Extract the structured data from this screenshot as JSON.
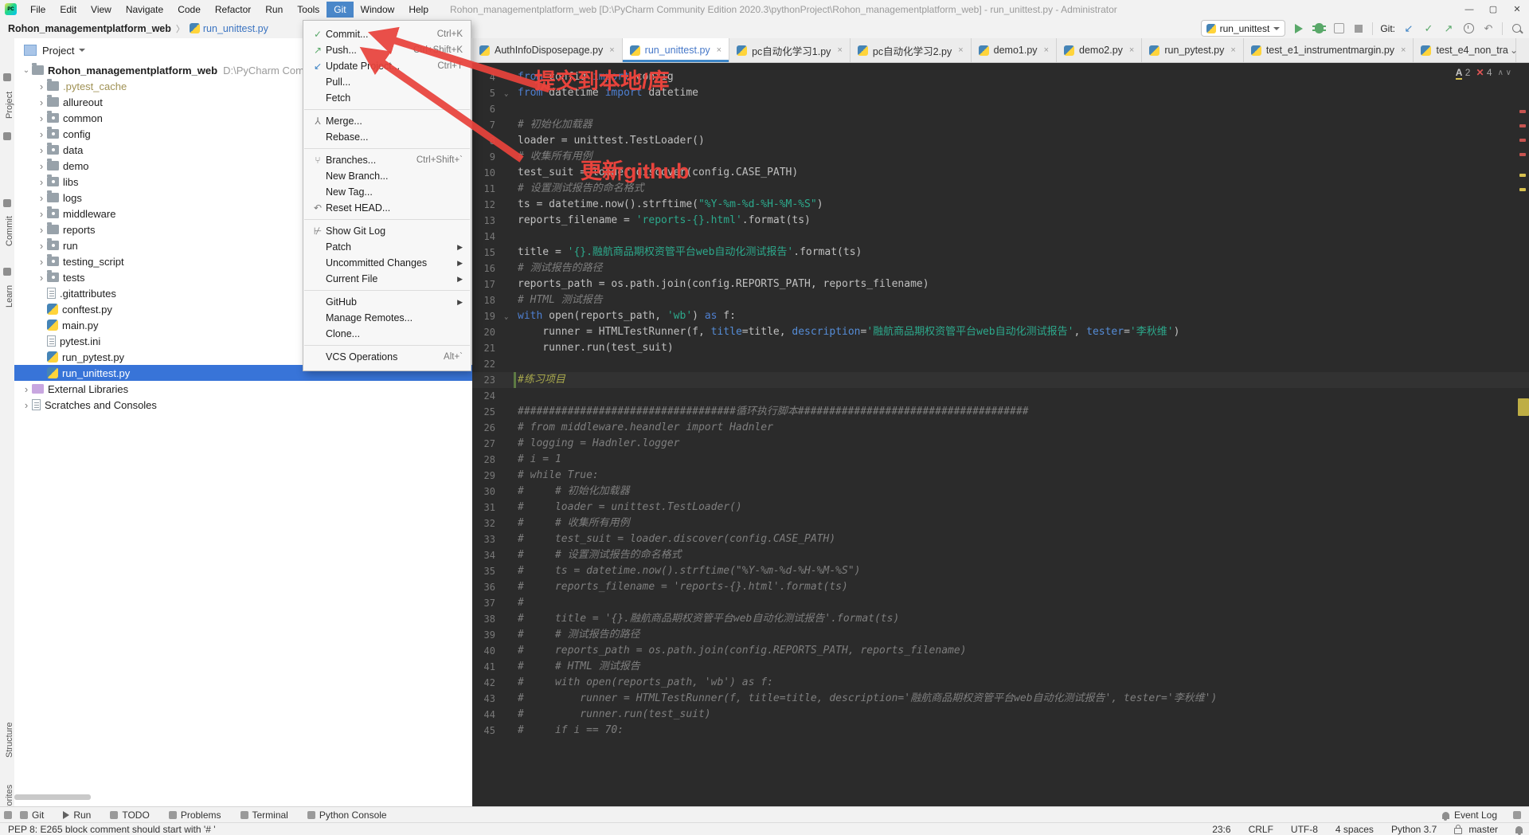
{
  "colors": {
    "accent_red": "#e8433c",
    "selection_blue": "#3874d8",
    "menu_highlight": "#4a87c9",
    "keyword": "#4e7fd0",
    "string": "#2ca98c",
    "comment": "#7e7e7e",
    "editor_bg": "#2b2b2b"
  },
  "title_bar": {
    "logo": "PC",
    "menus": [
      "File",
      "Edit",
      "View",
      "Navigate",
      "Code",
      "Refactor",
      "Run",
      "Tools",
      "Git",
      "Window",
      "Help"
    ],
    "active_menu": "Git",
    "title": "Rohon_managementplatform_web [D:\\PyCharm Community Edition 2020.3\\pythonProject\\Rohon_managementplatform_web] - run_unittest.py - Administrator",
    "window_buttons": {
      "minimize": "—",
      "maximize": "▢",
      "close": "✕"
    }
  },
  "breadcrumb": {
    "project": "Rohon_managementplatform_web",
    "separator": "〉",
    "file": "run_unittest.py"
  },
  "toolbar": {
    "run_config": "run_unittest",
    "git_label": "Git:"
  },
  "git_menu": {
    "items": [
      {
        "label": "Commit...",
        "shortcut": "Ctrl+K",
        "icon": "check-icon",
        "color": "ic-green",
        "glyph": "✓"
      },
      {
        "label": "Push...",
        "shortcut": "Ctrl+Shift+K",
        "icon": "arrow-up-right-icon",
        "color": "ic-green",
        "glyph": "↗"
      },
      {
        "label": "Update Project...",
        "shortcut": "Ctrl+T",
        "icon": "arrow-down-left-icon",
        "color": "ic-blue",
        "glyph": "↙"
      },
      {
        "label": "Pull..."
      },
      {
        "label": "Fetch",
        "sep": true
      },
      {
        "label": "Merge...",
        "icon": "merge-icon",
        "color": "ic-dim",
        "glyph": "⅄"
      },
      {
        "label": "Rebase...",
        "sep": true
      },
      {
        "label": "Branches...",
        "shortcut": "Ctrl+Shift+`",
        "icon": "branch-icon",
        "color": "ic-dim",
        "glyph": "⑂"
      },
      {
        "label": "New Branch..."
      },
      {
        "label": "New Tag..."
      },
      {
        "label": "Reset HEAD...",
        "icon": "undo-icon",
        "color": "ic-dim",
        "glyph": "↶",
        "sep": true
      },
      {
        "label": "Show Git Log",
        "icon": "log-icon",
        "color": "ic-dim",
        "glyph": "⊬"
      },
      {
        "label": "Patch",
        "submenu": true
      },
      {
        "label": "Uncommitted Changes",
        "submenu": true
      },
      {
        "label": "Current File",
        "submenu": true,
        "sep": true
      },
      {
        "label": "GitHub",
        "submenu": true
      },
      {
        "label": "Manage Remotes..."
      },
      {
        "label": "Clone...",
        "sep": true
      },
      {
        "label": "VCS Operations",
        "shortcut": "Alt+`"
      }
    ]
  },
  "annotations": {
    "commit_note": "提交到本地/库",
    "push_note": "更新github"
  },
  "project_panel": {
    "header": "Project",
    "tree": [
      {
        "label": "Rohon_managementplatform_web",
        "suffix": "D:\\PyCharm Comm",
        "depth": 0,
        "chev": "v",
        "icon": "folder",
        "bold": true
      },
      {
        "label": ".pytest_cache",
        "depth": 1,
        "chev": ">",
        "icon": "folder",
        "cls": "t-excl"
      },
      {
        "label": "allureout",
        "depth": 1,
        "chev": ">",
        "icon": "folder"
      },
      {
        "label": "common",
        "depth": 1,
        "chev": ">",
        "icon": "pkg"
      },
      {
        "label": "config",
        "depth": 1,
        "chev": ">",
        "icon": "pkg"
      },
      {
        "label": "data",
        "depth": 1,
        "chev": ">",
        "icon": "pkg"
      },
      {
        "label": "demo",
        "depth": 1,
        "chev": ">",
        "icon": "folder"
      },
      {
        "label": "libs",
        "depth": 1,
        "chev": ">",
        "icon": "pkg"
      },
      {
        "label": "logs",
        "depth": 1,
        "chev": ">",
        "icon": "folder"
      },
      {
        "label": "middleware",
        "depth": 1,
        "chev": ">",
        "icon": "pkg"
      },
      {
        "label": "reports",
        "depth": 1,
        "chev": ">",
        "icon": "folder"
      },
      {
        "label": "run",
        "depth": 1,
        "chev": ">",
        "icon": "pkg"
      },
      {
        "label": "testing_script",
        "depth": 1,
        "chev": ">",
        "icon": "pkg"
      },
      {
        "label": "tests",
        "depth": 1,
        "chev": ">",
        "icon": "pkg"
      },
      {
        "label": ".gitattributes",
        "depth": 1,
        "chev": "",
        "icon": "file"
      },
      {
        "label": "conftest.py",
        "depth": 1,
        "chev": "",
        "icon": "py"
      },
      {
        "label": "main.py",
        "depth": 1,
        "chev": "",
        "icon": "py"
      },
      {
        "label": "pytest.ini",
        "depth": 1,
        "chev": "",
        "icon": "file"
      },
      {
        "label": "run_pytest.py",
        "depth": 1,
        "chev": "",
        "icon": "py"
      },
      {
        "label": "run_unittest.py",
        "depth": 1,
        "chev": "",
        "icon": "py",
        "selected": true
      },
      {
        "label": "External Libraries",
        "depth": 0,
        "chev": ">",
        "icon": "lib"
      },
      {
        "label": "Scratches and Consoles",
        "depth": 0,
        "chev": ">",
        "icon": "file"
      }
    ]
  },
  "left_stripe": {
    "top": [
      "Project",
      "Commit",
      "Learn"
    ],
    "bottom": [
      "Structure",
      "Favorites"
    ]
  },
  "editor": {
    "tabs": [
      {
        "label": "AuthInfoDisposepage.py",
        "close": "×"
      },
      {
        "label": "run_unittest.py",
        "close": "×",
        "active": true,
        "blue": true
      },
      {
        "label": "pc自动化学习1.py",
        "close": "×"
      },
      {
        "label": "pc自动化学习2.py",
        "close": "×"
      },
      {
        "label": "demo1.py",
        "close": "×"
      },
      {
        "label": "demo2.py",
        "close": "×"
      },
      {
        "label": "run_pytest.py",
        "close": "×"
      },
      {
        "label": "test_e1_instrumentmargin.py",
        "close": "×"
      },
      {
        "label": "test_e4_non_tra",
        "close": ""
      }
    ],
    "inspection": {
      "warn_label": "A",
      "warnings": "2",
      "error_glyph": "✕",
      "errors": "4"
    },
    "code": [
      {
        "n": 4,
        "seg": [
          [
            "ck",
            "from"
          ],
          [
            "ct",
            " config "
          ],
          [
            "ck",
            "import"
          ],
          [
            "ct",
            " config"
          ]
        ]
      },
      {
        "n": 5,
        "fold": true,
        "seg": [
          [
            "ck",
            "from"
          ],
          [
            "ct",
            " datetime "
          ],
          [
            "ck",
            "import"
          ],
          [
            "ct",
            " datetime"
          ]
        ]
      },
      {
        "n": 6,
        "seg": []
      },
      {
        "n": 7,
        "seg": [
          [
            "cc",
            "# 初始化加载器"
          ]
        ]
      },
      {
        "n": 8,
        "seg": [
          [
            "ct",
            "loader = unittest.TestLoader()"
          ]
        ]
      },
      {
        "n": 9,
        "seg": [
          [
            "cc",
            "# 收集所有用例"
          ]
        ]
      },
      {
        "n": 10,
        "seg": [
          [
            "ct",
            "test_suit = loader.discover(config.CASE_PATH)"
          ]
        ]
      },
      {
        "n": 11,
        "seg": [
          [
            "cc",
            "# 设置测试报告的命名格式"
          ]
        ]
      },
      {
        "n": 12,
        "seg": [
          [
            "ct",
            "ts = datetime.now().strftime("
          ],
          [
            "cs",
            "\"%Y-%m-%d-%H-%M-%S\""
          ],
          [
            "ct",
            ")"
          ]
        ]
      },
      {
        "n": 13,
        "seg": [
          [
            "ct",
            "reports_filename = "
          ],
          [
            "cs",
            "'reports-{}.html'"
          ],
          [
            "ct",
            ".format(ts)"
          ]
        ]
      },
      {
        "n": 14,
        "seg": []
      },
      {
        "n": 15,
        "seg": [
          [
            "ct",
            "title = "
          ],
          [
            "cs",
            "'{}.融航商品期权资管平台web自动化测试报告'"
          ],
          [
            "ct",
            ".format(ts)"
          ]
        ]
      },
      {
        "n": 16,
        "seg": [
          [
            "cc",
            "# 测试报告的路径"
          ]
        ]
      },
      {
        "n": 17,
        "seg": [
          [
            "ct",
            "reports_path = os.path.join(config.REPORTS_PATH, reports_filename)"
          ]
        ]
      },
      {
        "n": 18,
        "seg": [
          [
            "cc",
            "# HTML 测试报告"
          ]
        ]
      },
      {
        "n": 19,
        "fold": true,
        "seg": [
          [
            "ck",
            "with"
          ],
          [
            "ct",
            " open(reports_path, "
          ],
          [
            "cs",
            "'wb'"
          ],
          [
            "ct",
            ") "
          ],
          [
            "ck",
            "as"
          ],
          [
            "ct",
            " f:"
          ]
        ]
      },
      {
        "n": 20,
        "seg": [
          [
            "ct",
            "    runner = HTMLTestRunner(f, "
          ],
          [
            "cp",
            "title"
          ],
          [
            "ct",
            "=title, "
          ],
          [
            "cp",
            "description"
          ],
          [
            "ct",
            "="
          ],
          [
            "cs",
            "'融航商品期权资管平台web自动化测试报告'"
          ],
          [
            "ct",
            ", "
          ],
          [
            "cp",
            "tester"
          ],
          [
            "ct",
            "="
          ],
          [
            "cs",
            "'李秋维'"
          ],
          [
            "ct",
            ")"
          ]
        ]
      },
      {
        "n": 21,
        "seg": [
          [
            "ct",
            "    runner.run(test_suit)"
          ]
        ]
      },
      {
        "n": 22,
        "seg": []
      },
      {
        "n": 23,
        "cur": true,
        "seg": [
          [
            "co",
            "#练习项目"
          ]
        ]
      },
      {
        "n": 24,
        "seg": []
      },
      {
        "n": 25,
        "seg": [
          [
            "cc",
            "###################################循环执行脚本#####################################"
          ]
        ]
      },
      {
        "n": 26,
        "seg": [
          [
            "cc",
            "# from middleware.heandler import Hadnler"
          ]
        ]
      },
      {
        "n": 27,
        "seg": [
          [
            "cc",
            "# logging = Hadnler.logger"
          ]
        ]
      },
      {
        "n": 28,
        "seg": [
          [
            "cc",
            "# i = 1"
          ]
        ]
      },
      {
        "n": 29,
        "seg": [
          [
            "cc",
            "# while True:"
          ]
        ]
      },
      {
        "n": 30,
        "seg": [
          [
            "cc",
            "#     # 初始化加载器"
          ]
        ]
      },
      {
        "n": 31,
        "seg": [
          [
            "cc",
            "#     loader = unittest.TestLoader()"
          ]
        ]
      },
      {
        "n": 32,
        "seg": [
          [
            "cc",
            "#     # 收集所有用例"
          ]
        ]
      },
      {
        "n": 33,
        "seg": [
          [
            "cc",
            "#     test_suit = loader.discover(config.CASE_PATH)"
          ]
        ]
      },
      {
        "n": 34,
        "seg": [
          [
            "cc",
            "#     # 设置测试报告的命名格式"
          ]
        ]
      },
      {
        "n": 35,
        "seg": [
          [
            "cc",
            "#     ts = datetime.now().strftime(\"%Y-%m-%d-%H-%M-%S\")"
          ]
        ]
      },
      {
        "n": 36,
        "seg": [
          [
            "cc",
            "#     reports_filename = 'reports-{}.html'.format(ts)"
          ]
        ]
      },
      {
        "n": 37,
        "seg": [
          [
            "cc",
            "#"
          ]
        ]
      },
      {
        "n": 38,
        "seg": [
          [
            "cc",
            "#     title = '{}.融航商品期权资管平台web自动化测试报告'.format(ts)"
          ]
        ]
      },
      {
        "n": 39,
        "seg": [
          [
            "cc",
            "#     # 测试报告的路径"
          ]
        ]
      },
      {
        "n": 40,
        "seg": [
          [
            "cc",
            "#     reports_path = os.path.join(config.REPORTS_PATH, reports_filename)"
          ]
        ]
      },
      {
        "n": 41,
        "seg": [
          [
            "cc",
            "#     # HTML 测试报告"
          ]
        ]
      },
      {
        "n": 42,
        "seg": [
          [
            "cc",
            "#     with open(reports_path, 'wb') as f:"
          ]
        ]
      },
      {
        "n": 43,
        "seg": [
          [
            "cc",
            "#         runner = HTMLTestRunner(f, title=title, description='融航商品期权资管平台web自动化测试报告', tester='李秋维')"
          ]
        ]
      },
      {
        "n": 44,
        "seg": [
          [
            "cc",
            "#         runner.run(test_suit)"
          ]
        ]
      },
      {
        "n": 45,
        "seg": [
          [
            "cc",
            "#     if i == 70:"
          ]
        ]
      }
    ]
  },
  "bottom_stripe": {
    "left": [
      {
        "label": "Git",
        "icon": "git-toolwindow-icon"
      },
      {
        "label": "Run",
        "icon": "run-icon",
        "play": true
      },
      {
        "label": "TODO",
        "icon": "todo-icon"
      },
      {
        "label": "Problems",
        "icon": "problems-icon"
      },
      {
        "label": "Terminal",
        "icon": "terminal-icon"
      },
      {
        "label": "Python Console",
        "icon": "python-console-icon"
      }
    ],
    "right": {
      "label": "Event Log",
      "icon": "event-log-icon"
    }
  },
  "status_bar": {
    "left": "PEP 8: E265 block comment should start with '# '",
    "items": [
      "23:6",
      "CRLF",
      "UTF-8",
      "4 spaces",
      "Python 3.7"
    ],
    "branch": "master"
  }
}
